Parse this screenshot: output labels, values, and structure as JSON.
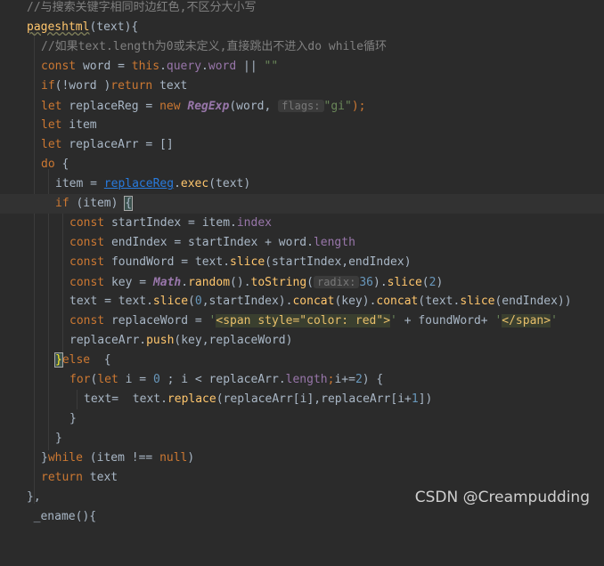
{
  "code": {
    "comment_top": "//与搜索关键字相同时边红色,不区分大小写",
    "fn_name": "pageshtml",
    "fn_sig_rest": "(text){",
    "comment_length": "//如果text.length为0或未定义,直接跳出不进入do while循环",
    "line_const_word": {
      "kw": "const",
      "rest1": " word = ",
      "this": "this",
      "dot": ".",
      "query": "query",
      "dot2": ".",
      "word": "word",
      "rest2": " || ",
      "str": "\"\""
    },
    "line_if_word": {
      "kw1": "if",
      "rest": "(!word )",
      "kw2": "return",
      "rest2": " text"
    },
    "line_let_regex": {
      "kw": "let",
      "rest1": " replaceReg = ",
      "new": "new",
      "sp": " ",
      "cls": "RegExp",
      "rest2": "(word, ",
      "hint": "flags:",
      "str": "\"gi\"",
      "end": ");"
    },
    "line_let_item": {
      "kw": "let",
      "rest": " item"
    },
    "line_let_arr": {
      "kw": "let",
      "rest": " replaceArr = []"
    },
    "line_do": {
      "kw": "do",
      "rest": " {"
    },
    "line_exec": {
      "pre": "item = ",
      "link": "replaceReg",
      "dot": ".",
      "fn": "exec",
      "post": "(text)"
    },
    "line_if_item": {
      "kw": "if",
      "rest": " (item) ",
      "brace": "{"
    },
    "line_start": {
      "kw": "const",
      "rest": " startIndex = item.",
      "prop": "index"
    },
    "line_end": {
      "kw": "const",
      "rest": " endIndex = startIndex + word.",
      "prop": "length"
    },
    "line_found": {
      "kw": "const",
      "rest": " foundWord = text.",
      "fn": "slice",
      "post": "(startIndex,endIndex)"
    },
    "line_key": {
      "kw": "const",
      "rest": " key = ",
      "cls": "Math",
      "dot": ".",
      "fn1": "random",
      "mid": "().",
      "fn2": "toString",
      "paren": "(",
      "hint": "radix:",
      "num": "36",
      "mid2": ").",
      "fn3": "slice",
      "paren2": "(",
      "num2": "2",
      "end": ")"
    },
    "line_text": {
      "pre": "text = text.",
      "fn1": "slice",
      "p1": "(",
      "n1": "0",
      "p2": ",startIndex).",
      "fn2": "concat",
      "p3": "(key).",
      "fn3": "concat",
      "p4": "(text.",
      "fn4": "slice",
      "p5": "(endIndex))"
    },
    "line_replaceword": {
      "kw": "const",
      "rest": " replaceWord = ",
      "q1": "'",
      "tag1": "<span style=\"color: red\">",
      "q2": "'",
      "mid": " + foundWord+ ",
      "q3": "'",
      "tag2": "</span>",
      "q4": "'"
    },
    "line_push": {
      "pre": "replaceArr.",
      "fn": "push",
      "post": "(key,replaceWord)"
    },
    "line_else": {
      "brace": "}",
      "kw": "else",
      "rest": "  {"
    },
    "line_for": {
      "kw1": "for",
      "p1": "(",
      "kw2": "let",
      "rest1": " i = ",
      "n1": "0",
      "rest2": " ; i < replaceArr.",
      "prop": "length",
      "semi": ";",
      "rest3": "i+=",
      "n2": "2",
      "end": ") {"
    },
    "line_replace": {
      "pre": "text=  text.",
      "fn": "replace",
      "p1": "(replaceArr[i],replaceArr[i+",
      "n": "1",
      "end": "])"
    },
    "line_close_for": "}",
    "line_close_if": "}",
    "line_while": {
      "pre": "}",
      "kw": "while",
      "mid": " (item !== ",
      "kw2": "null",
      "end": ")"
    },
    "line_return": {
      "kw": "return",
      "rest": " text"
    },
    "line_close_fn": "},",
    "line_next": "  _ename(){"
  },
  "watermark": "CSDN @Creampudding"
}
